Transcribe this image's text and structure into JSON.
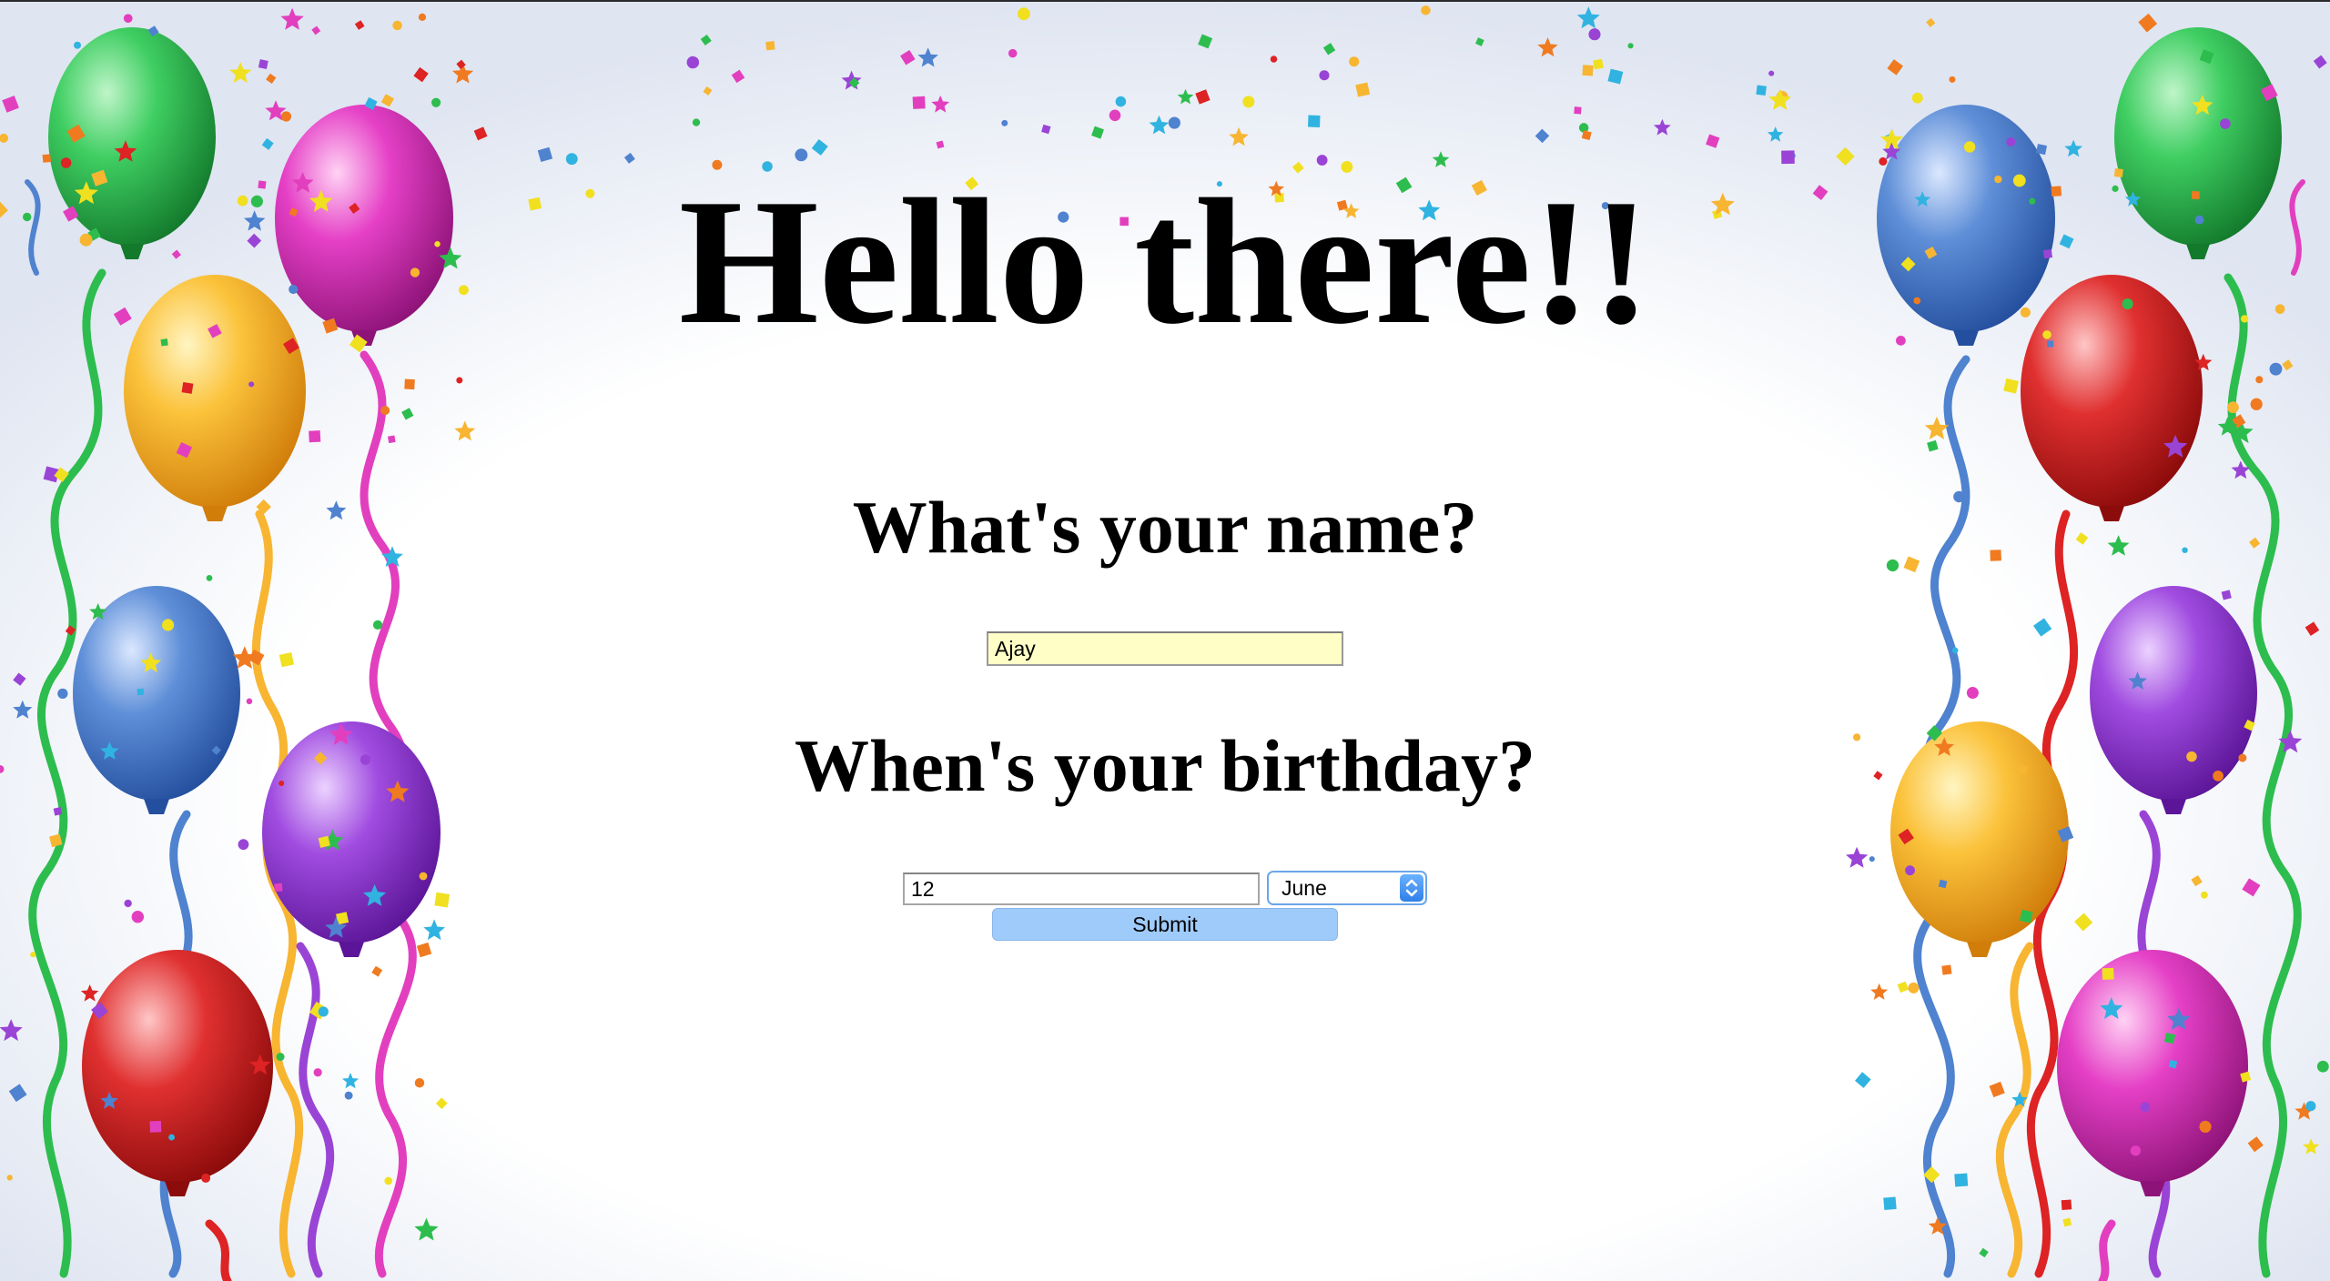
{
  "page": {
    "greeting": "Hello there!!",
    "name_question": "What's your name?",
    "birthday_question": "When's your birthday?"
  },
  "form": {
    "name_value": "Ajay",
    "day_value": "12",
    "month_selected": "June",
    "submit_label": "Submit"
  },
  "icons": {
    "month_select_arrows": "chevron-up-down-icon"
  },
  "colors": {
    "name_field_background": "#fefec6",
    "submit_button": "#9fcbfa",
    "select_border": "#6aa6ea",
    "select_arrows": "#3b8af0",
    "balloons": [
      "#2dbd4e",
      "#e23fbf",
      "#f7b531",
      "#4f82cf",
      "#9a44d6",
      "#dd2323"
    ]
  }
}
